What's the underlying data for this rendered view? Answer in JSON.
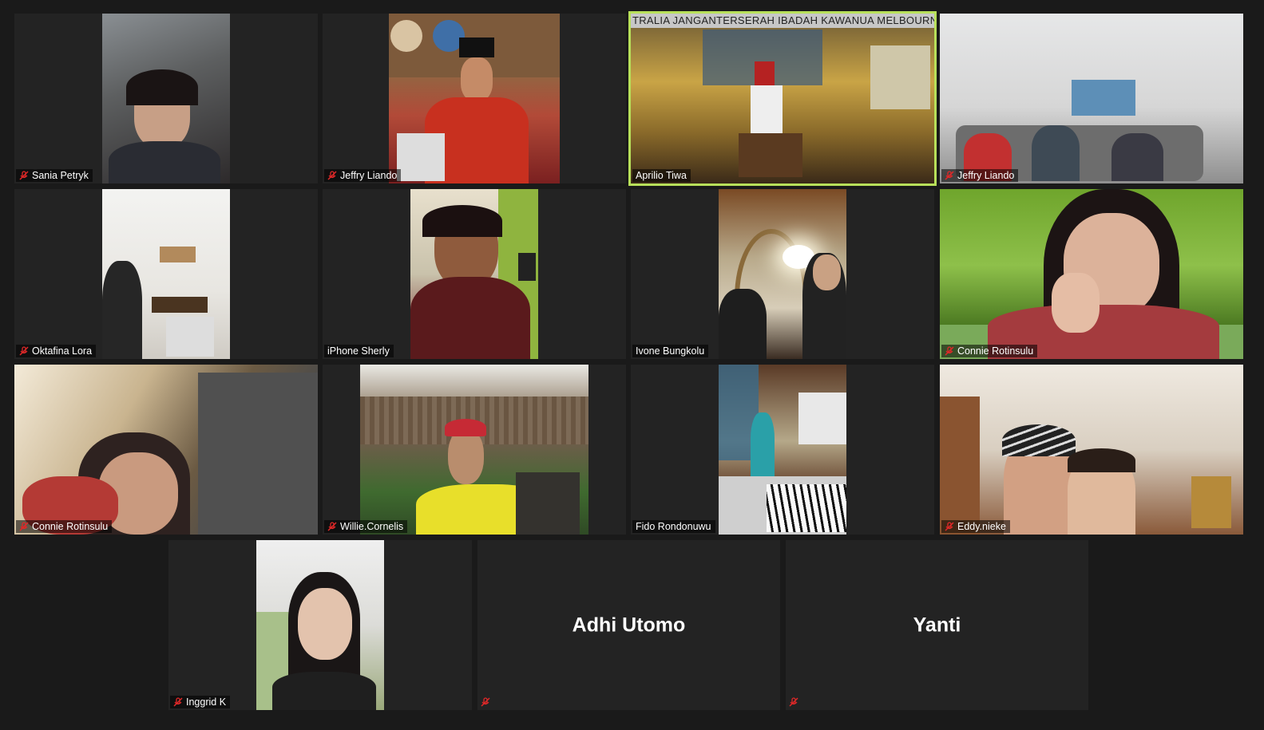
{
  "meeting": {
    "participants": [
      {
        "name": "Sania Petryk",
        "muted": true
      },
      {
        "name": "Jeffry Liando",
        "muted": true
      },
      {
        "name": "Aprilio Tiwa",
        "muted": false,
        "active_speaker": true,
        "banner": "TRALIA JANGANTERSERAH  IBADAH KAWANUA MELBOURNE"
      },
      {
        "name": "Jeffry Liando",
        "muted": true
      },
      {
        "name": "Oktafina Lora",
        "muted": true
      },
      {
        "name": "iPhone Sherly",
        "muted": false
      },
      {
        "name": "Ivone Bungkolu",
        "muted": false
      },
      {
        "name": "Connie Rotinsulu",
        "muted": true
      },
      {
        "name": "Connie Rotinsulu",
        "muted": true
      },
      {
        "name": "Willie.Cornelis",
        "muted": true
      },
      {
        "name": "Fido Rondonuwu",
        "muted": false
      },
      {
        "name": "Eddy.nieke",
        "muted": true
      },
      {
        "name": "Inggrid K",
        "muted": true
      },
      {
        "name": "Adhi Utomo",
        "muted": true,
        "video_off": true
      },
      {
        "name": "Yanti",
        "muted": true,
        "video_off": true
      }
    ]
  },
  "colors": {
    "background": "#1a1a1a",
    "tile": "#232323",
    "active_border": "#b8e05a",
    "mute_red": "#e02828"
  },
  "icons": {
    "mute": "microphone-muted-icon"
  }
}
